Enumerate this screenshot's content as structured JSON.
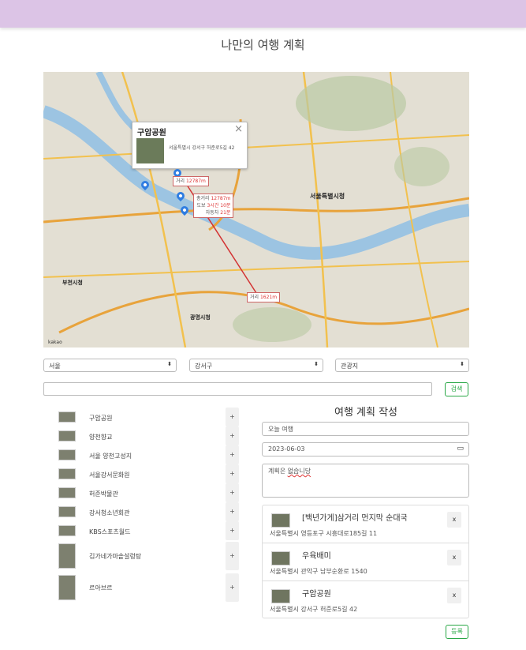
{
  "page": {
    "title": "나만의 여행 계획"
  },
  "map": {
    "popup": {
      "title": "구암공원",
      "address": "서울특별시 강서구 허준로5길 42",
      "close": "×"
    },
    "distance_labels": [
      {
        "label": "거리",
        "value": "12787m"
      },
      {
        "label": "거리",
        "value": "1621m"
      }
    ],
    "summary": {
      "total_label": "총거리",
      "total_value": "12787m",
      "walk_label": "도보",
      "walk_hours": "3시간",
      "walk_minutes": "10분",
      "car_label": "자동차",
      "car_minutes": "21분"
    },
    "city_labels": [
      "서울특별시청",
      "부천시청",
      "광명시청"
    ],
    "logo": "kakao"
  },
  "filters": {
    "region": "서울",
    "district": "강서구",
    "category": "관광지",
    "arrow": "⬍"
  },
  "search": {
    "placeholder": "",
    "button": "검색"
  },
  "places": [
    {
      "name": "구암공원",
      "add": "+"
    },
    {
      "name": "양천향교",
      "add": "+"
    },
    {
      "name": "서울 양천고성지",
      "add": "+"
    },
    {
      "name": "서울강서문화원",
      "add": "+"
    },
    {
      "name": "허준박물관",
      "add": "+"
    },
    {
      "name": "강서청소년회관",
      "add": "+"
    },
    {
      "name": "KBS스포츠월드",
      "add": "+"
    },
    {
      "name": "김가네가마솥설렁탕",
      "add": "+"
    },
    {
      "name": "르아브르",
      "add": "+"
    }
  ],
  "plan": {
    "title": "여행 계획 작성",
    "name_value": "오늘 여행",
    "date_value": "2023-06-03",
    "memo_prefix": "계획은 ",
    "memo_underlined": "없습니당",
    "items": [
      {
        "name": "[백년가게]삼거리 먼지막 순대국",
        "address": "서울특별시 영등포구 시흥대로185길 11",
        "delete": "x"
      },
      {
        "name": "우육배미",
        "address": "서울특별시 관악구 남부순환로 1540",
        "delete": "x"
      },
      {
        "name": "구암공원",
        "address": "서울특별시 강서구 허준로5길 42",
        "delete": "x"
      }
    ],
    "submit": "등록"
  },
  "colors": {
    "topbar": "#dcc4e6",
    "accent_green": "#28a745",
    "route": "#d33333",
    "pin": "#2f7de1"
  }
}
